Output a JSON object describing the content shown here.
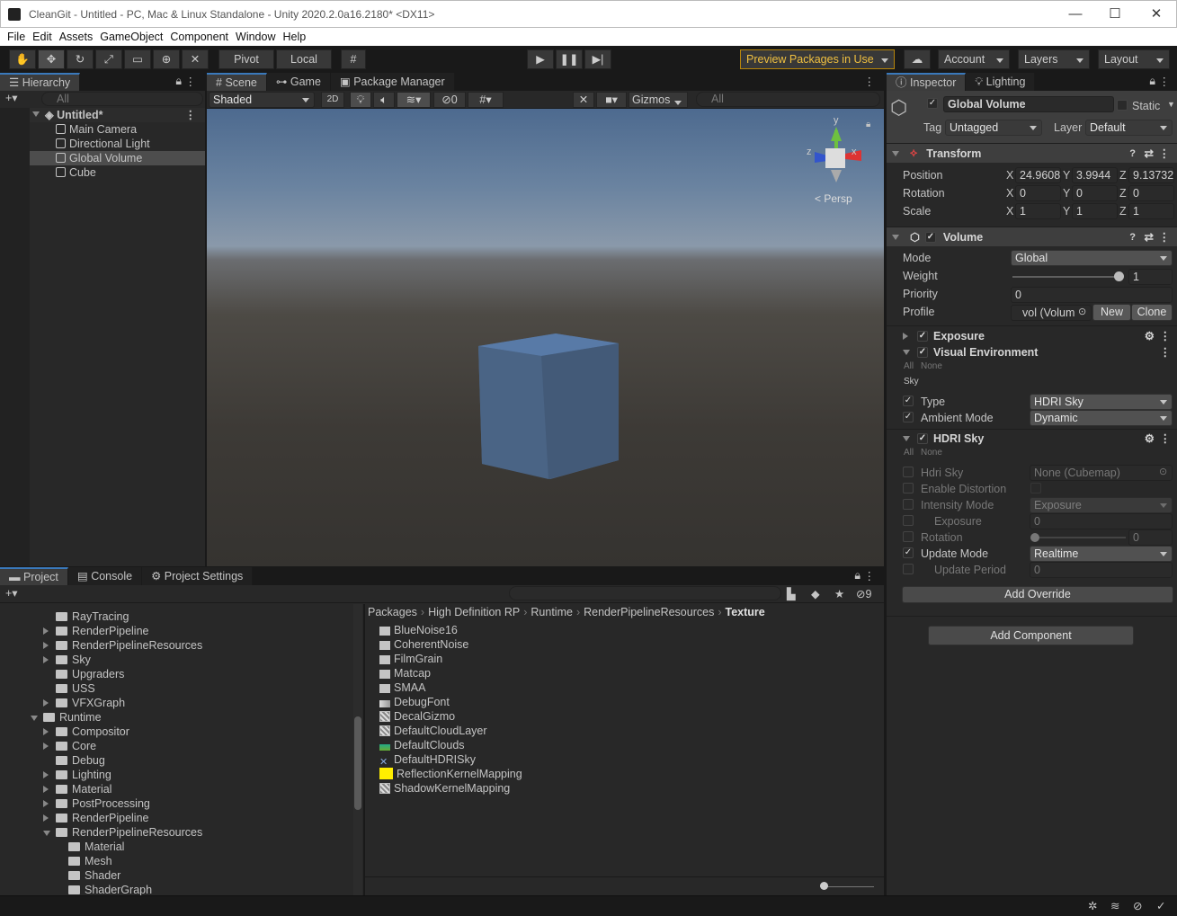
{
  "window": {
    "title": "CleanGit - Untitled - PC, Mac & Linux Standalone - Unity 2020.2.0a16.2180* <DX11>",
    "min": "—",
    "max": "☐",
    "close": "✕"
  },
  "menu": [
    "File",
    "Edit",
    "Assets",
    "GameObject",
    "Component",
    "Window",
    "Help"
  ],
  "toolbar": {
    "pivot": "Pivot",
    "local": "Local",
    "preview": "Preview Packages in Use",
    "account": "Account",
    "layers": "Layers",
    "layout": "Layout"
  },
  "hierarchy": {
    "tab": "Hierarchy",
    "search_placeholder": "All",
    "scene": "Untitled*",
    "items": [
      "Main Camera",
      "Directional Light",
      "Global Volume",
      "Cube"
    ]
  },
  "scene": {
    "tabs": [
      "Scene",
      "Game",
      "Package Manager"
    ],
    "shading": "Shaded",
    "mode2d": "2D",
    "hidden_count": "0",
    "gizmos": "Gizmos",
    "search_placeholder": "All",
    "persp": "Persp",
    "axis_y": "y",
    "axis_x": "x",
    "axis_z": "z"
  },
  "project": {
    "tabs": [
      "Project",
      "Console",
      "Project Settings"
    ],
    "hidden_count": "9",
    "tree": [
      {
        "label": "RayTracing",
        "indent": 62,
        "arrow": false,
        "open": false
      },
      {
        "label": "RenderPipeline",
        "indent": 62,
        "arrow": true,
        "open": false
      },
      {
        "label": "RenderPipelineResources",
        "indent": 62,
        "arrow": true,
        "open": false
      },
      {
        "label": "Sky",
        "indent": 62,
        "arrow": true,
        "open": false
      },
      {
        "label": "Upgraders",
        "indent": 62,
        "arrow": false,
        "open": false
      },
      {
        "label": "USS",
        "indent": 62,
        "arrow": false,
        "open": false
      },
      {
        "label": "VFXGraph",
        "indent": 62,
        "arrow": true,
        "open": false
      },
      {
        "label": "Runtime",
        "indent": 48,
        "arrow": true,
        "open": true
      },
      {
        "label": "Compositor",
        "indent": 62,
        "arrow": true,
        "open": false
      },
      {
        "label": "Core",
        "indent": 62,
        "arrow": true,
        "open": false
      },
      {
        "label": "Debug",
        "indent": 62,
        "arrow": false,
        "open": false
      },
      {
        "label": "Lighting",
        "indent": 62,
        "arrow": true,
        "open": false
      },
      {
        "label": "Material",
        "indent": 62,
        "arrow": true,
        "open": false
      },
      {
        "label": "PostProcessing",
        "indent": 62,
        "arrow": true,
        "open": false
      },
      {
        "label": "RenderPipeline",
        "indent": 62,
        "arrow": true,
        "open": false
      },
      {
        "label": "RenderPipelineResources",
        "indent": 62,
        "arrow": true,
        "open": true
      },
      {
        "label": "Material",
        "indent": 76,
        "arrow": false,
        "open": false
      },
      {
        "label": "Mesh",
        "indent": 76,
        "arrow": false,
        "open": false
      },
      {
        "label": "Shader",
        "indent": 76,
        "arrow": false,
        "open": false
      },
      {
        "label": "ShaderGraph",
        "indent": 76,
        "arrow": false,
        "open": false
      }
    ],
    "breadcrumb": [
      "Packages",
      "High Definition RP",
      "Runtime",
      "RenderPipelineResources",
      "Texture"
    ],
    "assets": [
      {
        "label": "BlueNoise16",
        "kind": "folder"
      },
      {
        "label": "CoherentNoise",
        "kind": "folder"
      },
      {
        "label": "FilmGrain",
        "kind": "folder"
      },
      {
        "label": "Matcap",
        "kind": "folder"
      },
      {
        "label": "SMAA",
        "kind": "folder"
      },
      {
        "label": "DebugFont",
        "kind": "font"
      },
      {
        "label": "DecalGizmo",
        "kind": "texture"
      },
      {
        "label": "DefaultCloudLayer",
        "kind": "texture"
      },
      {
        "label": "DefaultClouds",
        "kind": "clouds"
      },
      {
        "label": "DefaultHDRISky",
        "kind": "hdri"
      },
      {
        "label": "ReflectionKernelMapping",
        "kind": "yellow"
      },
      {
        "label": "ShadowKernelMapping",
        "kind": "texture"
      }
    ]
  },
  "inspector": {
    "tabs": [
      "Inspector",
      "Lighting"
    ],
    "object_name": "Global Volume",
    "static_label": "Static",
    "tag_label": "Tag",
    "tag_value": "Untagged",
    "layer_label": "Layer",
    "layer_value": "Default",
    "transform": {
      "title": "Transform",
      "rows": [
        {
          "label": "Position",
          "x": "24.9608",
          "y": "3.9944",
          "z": "9.13732"
        },
        {
          "label": "Rotation",
          "x": "0",
          "y": "0",
          "z": "0"
        },
        {
          "label": "Scale",
          "x": "1",
          "y": "1",
          "z": "1"
        }
      ]
    },
    "volume": {
      "title": "Volume",
      "mode_label": "Mode",
      "mode": "Global",
      "weight_label": "Weight",
      "weight": "1",
      "priority_label": "Priority",
      "priority": "0",
      "profile_label": "Profile",
      "profile": "vol (Volum",
      "new": "New",
      "clone": "Clone"
    },
    "exposure": "Exposure",
    "visual_env": {
      "title": "Visual Environment",
      "all": "All",
      "none": "None",
      "sky": "Sky",
      "type_label": "Type",
      "type": "HDRI Sky",
      "ambient_label": "Ambient Mode",
      "ambient": "Dynamic"
    },
    "hdri": {
      "title": "HDRI Sky",
      "all": "All",
      "none": "None",
      "rows": [
        {
          "label": "Hdri Sky",
          "value": "None (Cubemap)"
        },
        {
          "label": "Enable Distortion",
          "value": ""
        },
        {
          "label": "Intensity Mode",
          "value": "Exposure"
        },
        {
          "label": "Exposure",
          "value": "0"
        },
        {
          "label": "Rotation",
          "value": "0"
        },
        {
          "label": "Update Mode",
          "value": "Realtime"
        },
        {
          "label": "Update Period",
          "value": "0"
        }
      ]
    },
    "add_override": "Add Override",
    "add_component": "Add Component"
  }
}
